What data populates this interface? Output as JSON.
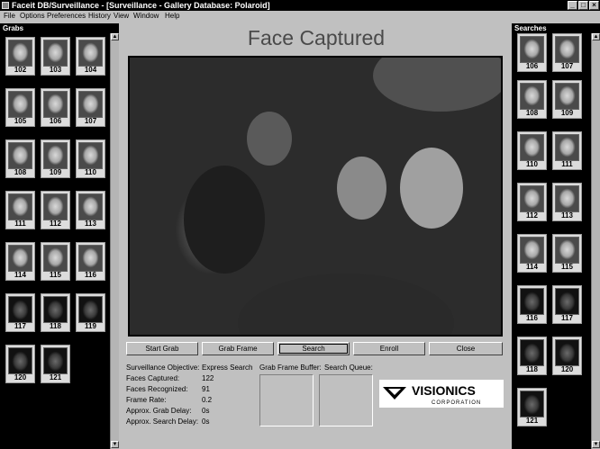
{
  "window": {
    "title": "Faceit DB/Surveillance - [Surveillance - Gallery Database: Polaroid]",
    "controls": [
      "_",
      "□",
      "×"
    ]
  },
  "menu": [
    "File",
    "Options",
    "Preferences",
    "History",
    "View",
    "Window",
    "Help"
  ],
  "grabs": {
    "title": "Grabs",
    "items": [
      "102",
      "103",
      "104",
      "105",
      "106",
      "107",
      "108",
      "109",
      "110",
      "111",
      "112",
      "113",
      "114",
      "115",
      "116",
      "117",
      "118",
      "119",
      "120",
      "121"
    ]
  },
  "searches": {
    "title": "Searches",
    "items": [
      "106",
      "107",
      "108",
      "109",
      "110",
      "111",
      "112",
      "113",
      "114",
      "115",
      "116",
      "117",
      "118",
      "120",
      "121"
    ]
  },
  "main": {
    "heading": "Face Captured",
    "buttons": {
      "start_grab": "Start Grab",
      "grab_frame": "Grab Frame",
      "search": "Search",
      "enroll": "Enroll",
      "close": "Close"
    },
    "stats": [
      {
        "label": "Surveillance Objective:",
        "value": "Express Search"
      },
      {
        "label": "Faces Captured:",
        "value": "122"
      },
      {
        "label": "Faces Recognized:",
        "value": "91"
      },
      {
        "label": "Frame Rate:",
        "value": "0.2"
      },
      {
        "label": "Approx. Grab Delay:",
        "value": "0s"
      },
      {
        "label": "Approx. Search Delay:",
        "value": "0s"
      }
    ],
    "grab_frame_buffer_label": "Grab Frame Buffer:",
    "search_queue_label": "Search Queue:"
  },
  "logo": {
    "name": "VISIONICS",
    "subtitle": "CORPORATION"
  }
}
